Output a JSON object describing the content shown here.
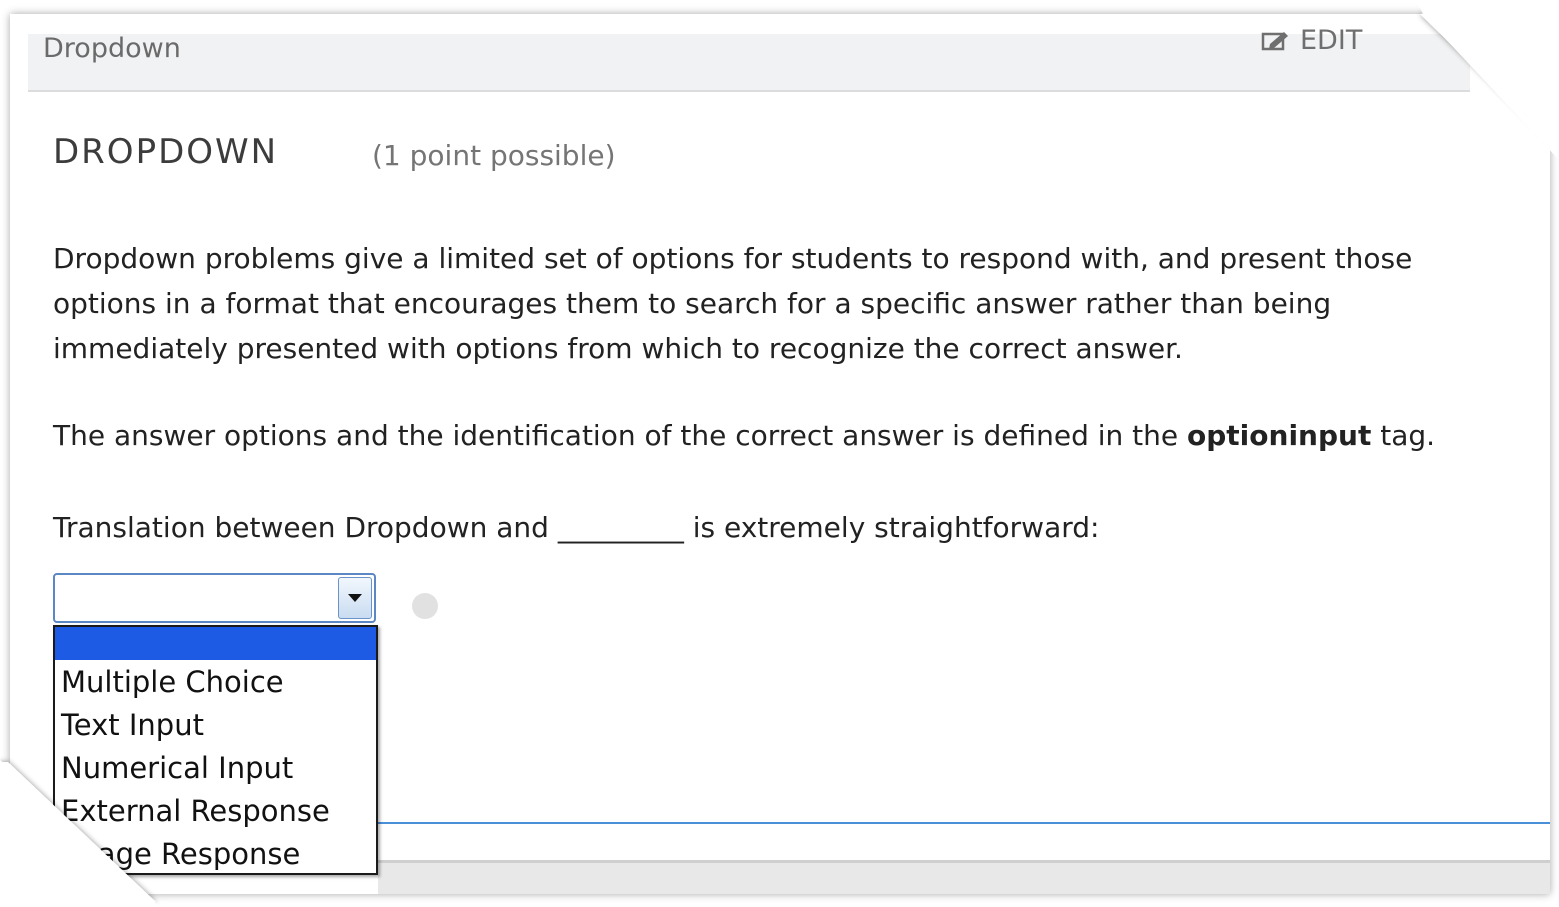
{
  "header": {
    "component_title": "Dropdown",
    "edit_label": "EDIT"
  },
  "problem": {
    "heading": "DROPDOWN",
    "points": "(1 point possible)",
    "paragraph1": "Dropdown problems give a limited set of options for students to respond with, and present those options in a format that encourages them to search for a specific answer rather than being immediately presented with options from which to recognize the correct answer.",
    "paragraph2_before": "The answer options and the identification of the correct answer is defined in the ",
    "paragraph2_bold": "optioninput",
    "paragraph2_after": " tag.",
    "question": "Translation between Dropdown and _________ is extremely straightforward:"
  },
  "dropdown": {
    "selected_value": "",
    "options": [
      "Multiple Choice",
      "Text Input",
      "Numerical Input",
      "External Response",
      "Image Response"
    ]
  },
  "colors": {
    "highlight": "#1e5be5",
    "select_border": "#5b87c5",
    "rule": "#4a90d9"
  },
  "icons": {
    "edit": "edit-icon",
    "dropdown_arrow": "chevron-down-icon",
    "status": "status-dot-icon"
  }
}
